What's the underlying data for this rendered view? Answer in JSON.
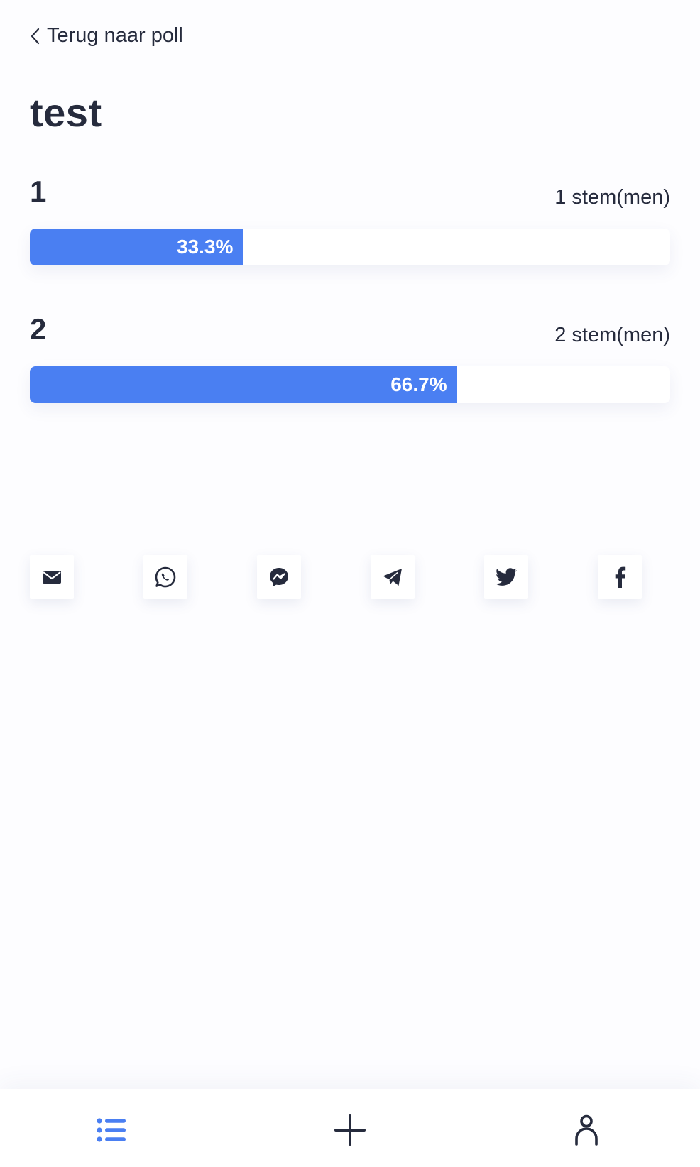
{
  "back_link": {
    "label": "Terug naar poll",
    "icon": "chevron-left-icon"
  },
  "poll": {
    "title": "test",
    "options": [
      {
        "label": "1",
        "votes_text": "1 stem(men)",
        "percent_text": "33.3%",
        "percent": 33.3
      },
      {
        "label": "2",
        "votes_text": "2 stem(men)",
        "percent_text": "66.7%",
        "percent": 66.7
      }
    ]
  },
  "share": {
    "buttons": [
      {
        "name": "email",
        "icon": "envelope-icon"
      },
      {
        "name": "whatsapp",
        "icon": "whatsapp-icon"
      },
      {
        "name": "messenger",
        "icon": "messenger-icon"
      },
      {
        "name": "telegram",
        "icon": "telegram-icon"
      },
      {
        "name": "twitter",
        "icon": "twitter-icon"
      },
      {
        "name": "facebook",
        "icon": "facebook-icon"
      }
    ]
  },
  "bottom_nav": {
    "items": [
      {
        "name": "polls-list",
        "icon": "list-icon",
        "active": true
      },
      {
        "name": "create-poll",
        "icon": "plus-icon",
        "active": false
      },
      {
        "name": "profile",
        "icon": "user-icon",
        "active": false
      }
    ]
  },
  "colors": {
    "accent": "#4a7ff2",
    "text": "#262b3d",
    "background": "#fdfdff"
  }
}
